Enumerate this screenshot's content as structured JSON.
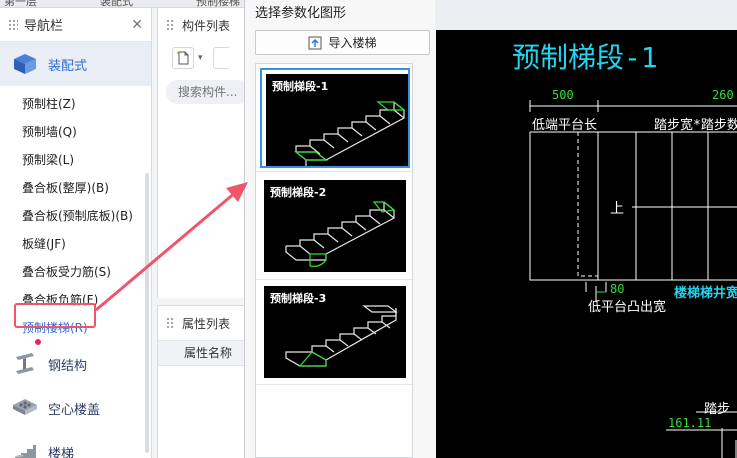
{
  "top_tabs": [
    "第一层",
    "装配式",
    "预制楼梯"
  ],
  "nav": {
    "title": "导航栏",
    "categories": [
      {
        "label": "装配式",
        "icon": "prefab-building-icon"
      },
      {
        "label": "钢结构",
        "icon": "steel-beam-icon"
      },
      {
        "label": "空心楼盖",
        "icon": "hollow-floor-icon"
      },
      {
        "label": "楼梯",
        "icon": "stair-icon"
      }
    ],
    "items": [
      "预制柱(Z)",
      "预制墙(Q)",
      "预制梁(L)",
      "叠合板(整厚)(B)",
      "叠合板(预制底板)(B)",
      "板缝(JF)",
      "叠合板受力筋(S)",
      "叠合板负筋(F)",
      "预制楼梯(R)"
    ]
  },
  "component_list": {
    "title": "构件列表",
    "search_placeholder": "搜索构件..."
  },
  "property_list": {
    "title": "属性列表",
    "column": "属性名称"
  },
  "dialog": {
    "title": "选择参数化图形",
    "import_button": "导入楼梯",
    "thumbnails": [
      "预制梯段-1",
      "预制梯段-2",
      "预制梯段-3"
    ],
    "selected_index": 0
  },
  "cad": {
    "title": "预制梯段-1",
    "dim_500": "500",
    "dim_260": "260",
    "label_low_platform_width": "低端平台长",
    "label_step_width": "踏步宽*踏步数",
    "label_up": "上",
    "dim_80": "80",
    "label_low_platform_offset": "低平台凸出宽",
    "label_stair_well": "楼梯梯井宽",
    "dim_161": "161.11",
    "label_tread": "踏步"
  },
  "colors": {
    "cad_cyan": "#22d4ee",
    "cad_green": "#33dd33",
    "cad_white": "#ffffff",
    "highlight_red": "#f0556b",
    "selection_blue": "#3a8ee6"
  }
}
